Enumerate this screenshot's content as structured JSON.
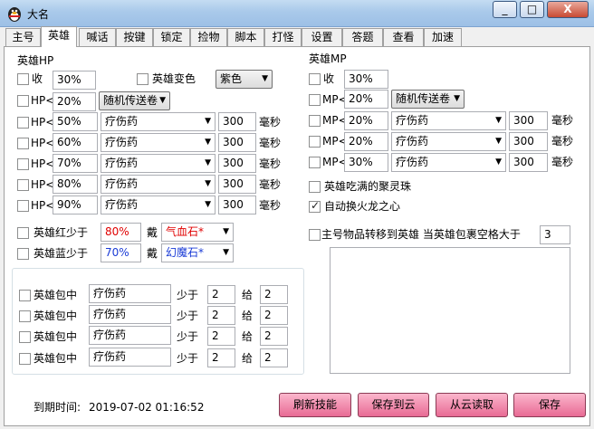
{
  "window": {
    "title": "大名",
    "buttons": [
      "_",
      "□",
      "X"
    ]
  },
  "tabs": [
    "主号",
    "英雄",
    "喊话",
    "按键",
    "锁定",
    "捡物",
    "脚本",
    "打怪",
    "设置",
    "答题",
    "查看",
    "加速"
  ],
  "hp": {
    "header": "英雄HP",
    "collect_label": "收",
    "collect_value": "30%",
    "transform_label": "英雄变色",
    "transform_color": "紫色",
    "hp_prefix": "HP<",
    "random_value": "20%",
    "random_option": "随机传送卷",
    "rows": [
      {
        "pct": "50%",
        "item": "疗伤药",
        "ms": "300"
      },
      {
        "pct": "60%",
        "item": "疗伤药",
        "ms": "300"
      },
      {
        "pct": "70%",
        "item": "疗伤药",
        "ms": "300"
      },
      {
        "pct": "80%",
        "item": "疗伤药",
        "ms": "300"
      },
      {
        "pct": "90%",
        "item": "疗伤药",
        "ms": "300"
      }
    ],
    "ms_unit": "毫秒"
  },
  "mp": {
    "header": "英雄MP",
    "collect_label": "收",
    "collect_value": "30%",
    "mp_prefix": "MP<",
    "random_value": "20%",
    "random_option": "随机传送卷",
    "rows": [
      {
        "pct": "20%",
        "item": "疗伤药",
        "ms": "300"
      },
      {
        "pct": "20%",
        "item": "疗伤药",
        "ms": "300"
      },
      {
        "pct": "30%",
        "item": "疗伤药",
        "ms": "300"
      }
    ],
    "ms_unit": "毫秒",
    "full_stone_label": "英雄吃满的聚灵珠",
    "auto_fire_label": "自动换火龙之心"
  },
  "equip": {
    "red_label": "英雄红少于",
    "red_value": "80%",
    "blue_label": "英雄蓝少于",
    "blue_value": "70%",
    "wear_label": "戴",
    "red_item": "气血石*",
    "blue_item": "幻魔石*"
  },
  "bag": {
    "row_label": "英雄包中",
    "less_label": "少于",
    "give_label": "给",
    "rows": [
      {
        "item": "疗伤药",
        "less": "2",
        "give": "2"
      },
      {
        "item": "疗伤药",
        "less": "2",
        "give": "2"
      },
      {
        "item": "疗伤药",
        "less": "2",
        "give": "2"
      },
      {
        "item": "疗伤药",
        "less": "2",
        "give": "2"
      }
    ]
  },
  "transfer": {
    "label": "主号物品转移到英雄 当英雄包裹空格大于",
    "value": "3"
  },
  "footer": {
    "expire_label": "到期时间:",
    "expire_value": "2019-07-02 01:16:52",
    "buttons": [
      "刷新技能",
      "保存到云",
      "从云读取",
      "保存"
    ]
  },
  "colors": {
    "accent_pink": "#f08aaa",
    "red_text": "#e00000",
    "blue_text": "#1a3bd6"
  }
}
